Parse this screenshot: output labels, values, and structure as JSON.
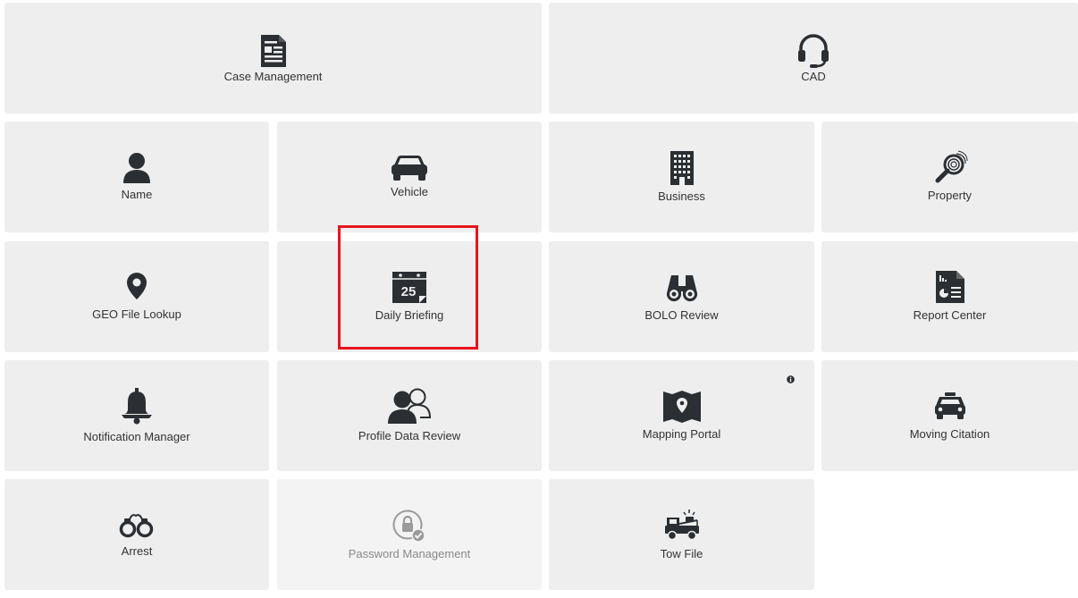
{
  "tiles": {
    "case_management": {
      "label": "Case Management",
      "icon": "newspaper-icon"
    },
    "cad": {
      "label": "CAD",
      "icon": "headset-icon"
    },
    "name": {
      "label": "Name",
      "icon": "user-icon"
    },
    "vehicle": {
      "label": "Vehicle",
      "icon": "car-icon"
    },
    "business": {
      "label": "Business",
      "icon": "building-icon"
    },
    "property": {
      "label": "Property",
      "icon": "fingerprint-magnifier-icon"
    },
    "geo_file_lookup": {
      "label": "GEO File Lookup",
      "icon": "map-pin-icon"
    },
    "daily_briefing": {
      "label": "Daily Briefing",
      "icon": "calendar-icon",
      "day": "25"
    },
    "bolo_review": {
      "label": "BOLO Review",
      "icon": "binoculars-icon"
    },
    "report_center": {
      "label": "Report Center",
      "icon": "report-document-icon"
    },
    "notification_manager": {
      "label": "Notification Manager",
      "icon": "bell-icon"
    },
    "profile_data_review": {
      "label": "Profile Data Review",
      "icon": "users-icon"
    },
    "mapping_portal": {
      "label": "Mapping Portal",
      "icon": "map-icon",
      "badge": "info-icon"
    },
    "moving_citation": {
      "label": "Moving Citation",
      "icon": "police-car-icon"
    },
    "arrest": {
      "label": "Arrest",
      "icon": "handcuffs-icon"
    },
    "password_management": {
      "label": "Password Management",
      "icon": "lock-check-icon",
      "state": "disabled"
    },
    "tow_file": {
      "label": "Tow File",
      "icon": "tow-truck-icon"
    }
  },
  "colors": {
    "tile_bg": "#eeeeee",
    "icon": "#2b2f33",
    "label": "#333333",
    "disabled_label": "#8a8a8a",
    "highlight": "#e8141b"
  }
}
